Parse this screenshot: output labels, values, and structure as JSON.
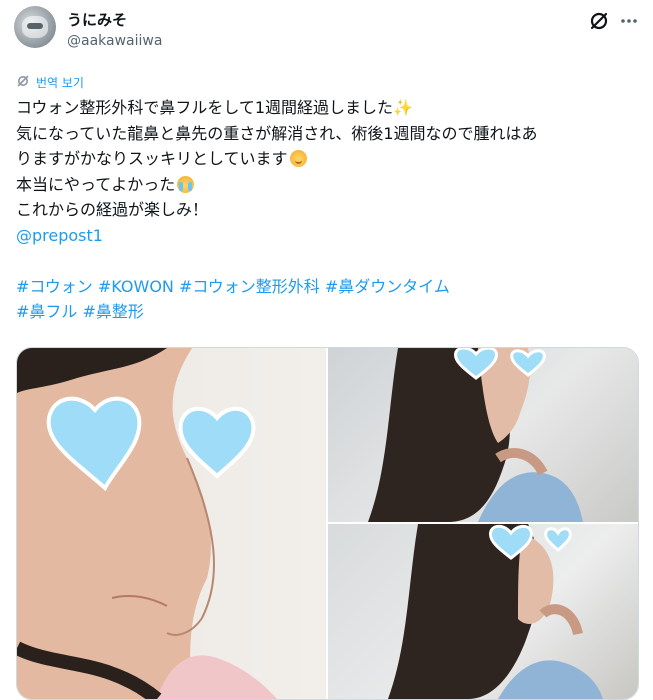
{
  "user": {
    "display_name": "うにみそ",
    "handle": "@aakawaiiwa",
    "avatar": "user-avatar"
  },
  "header_icons": {
    "grok": "grok-icon",
    "more": "more-options-icon"
  },
  "translate": {
    "icon": "translate-icon",
    "label": "번역 보기"
  },
  "tweet": {
    "line1": "コウォン整形外科で鼻フルをして1週間経過しました",
    "line1_emoji": "✨",
    "line2": "気になっていた龍鼻と鼻先の重さが解消され、術後1週間なので腫れはあ",
    "line3": "りますがかなりスッキリとしています",
    "line3_emoji": "smiling-face-emoji",
    "line4": "本当にやってよかった",
    "line4_emoji": "crying-face-emoji",
    "line5": "これからの経過が楽しみ！",
    "mention": "@prepost1",
    "hashtags_row1": [
      "#コウォン",
      "#KOWON",
      "#コウォン整形外科",
      "#鼻ダウンタイム"
    ],
    "hashtags_row2": [
      "#鼻フル",
      "#鼻整形"
    ]
  },
  "media": {
    "photos": [
      {
        "name": "close-up-face-photo",
        "stickers": "heart-stickers"
      },
      {
        "name": "side-profile-photo-top",
        "stickers": "heart-stickers"
      },
      {
        "name": "side-profile-photo-bottom",
        "stickers": "heart-stickers"
      }
    ]
  },
  "colors": {
    "accent": "#1d9bf0",
    "text": "#0f1419",
    "secondary": "#536471",
    "sticker": "#9fdcf7"
  }
}
